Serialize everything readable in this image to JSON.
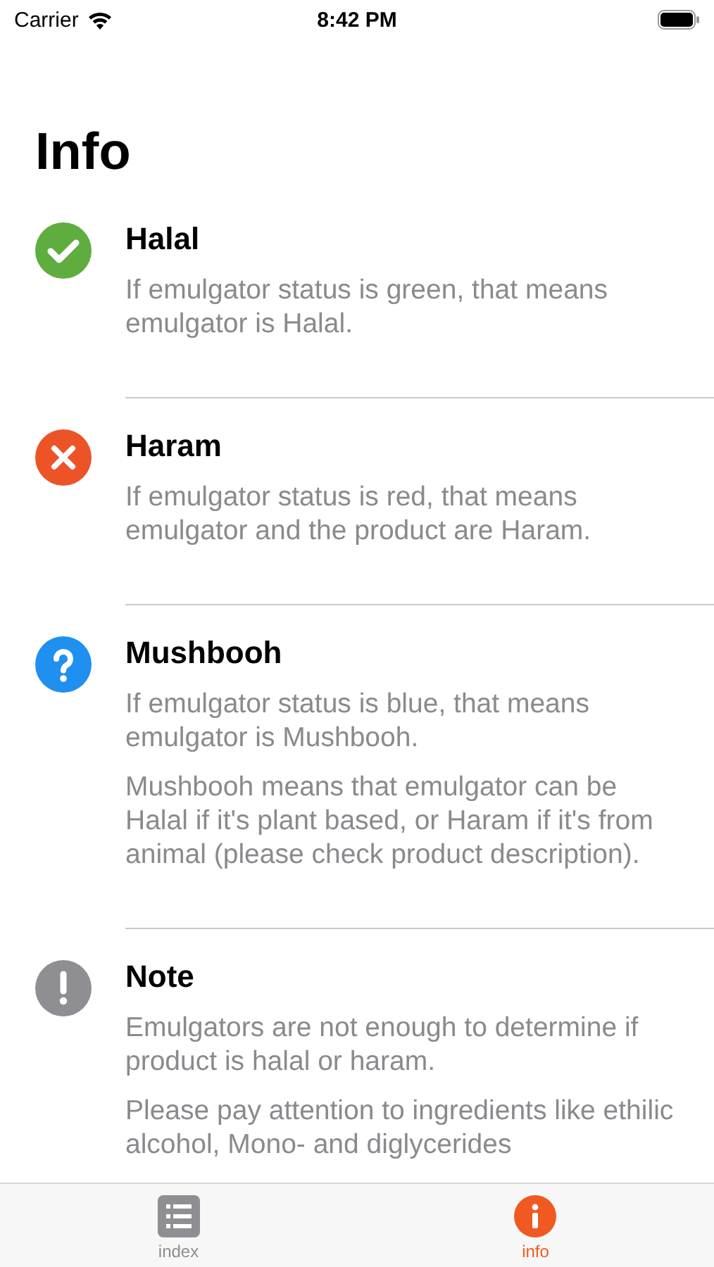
{
  "status_bar": {
    "carrier": "Carrier",
    "time": "8:42 PM"
  },
  "title": "Info",
  "items": [
    {
      "kind": "check",
      "color": "#5fad3f",
      "title": "Halal",
      "paragraphs": [
        "If emulgator status is green, that means emulgator is Halal."
      ]
    },
    {
      "kind": "cross",
      "color": "#ec5428",
      "title": "Haram",
      "paragraphs": [
        "If emulgator status is red, that means emulgator and the product are Haram."
      ]
    },
    {
      "kind": "question",
      "color": "#1f8ff0",
      "title": "Mushbooh",
      "paragraphs": [
        "If emulgator status is blue, that means emulgator is Mushbooh.",
        "Mushbooh means that emulgator can be Halal if it's plant based, or Haram if it's from animal (please check product description)."
      ]
    },
    {
      "kind": "exclamation",
      "color": "#8e8e93",
      "title": "Note",
      "paragraphs": [
        "Emulgators are not enough to determine if product is halal or haram.",
        "Please pay attention to ingredients like ethilic alcohol, Mono- and diglycerides"
      ]
    }
  ],
  "tabs": [
    {
      "kind": "list",
      "label": "index",
      "selected": false
    },
    {
      "kind": "info",
      "label": "info",
      "selected": true
    }
  ]
}
